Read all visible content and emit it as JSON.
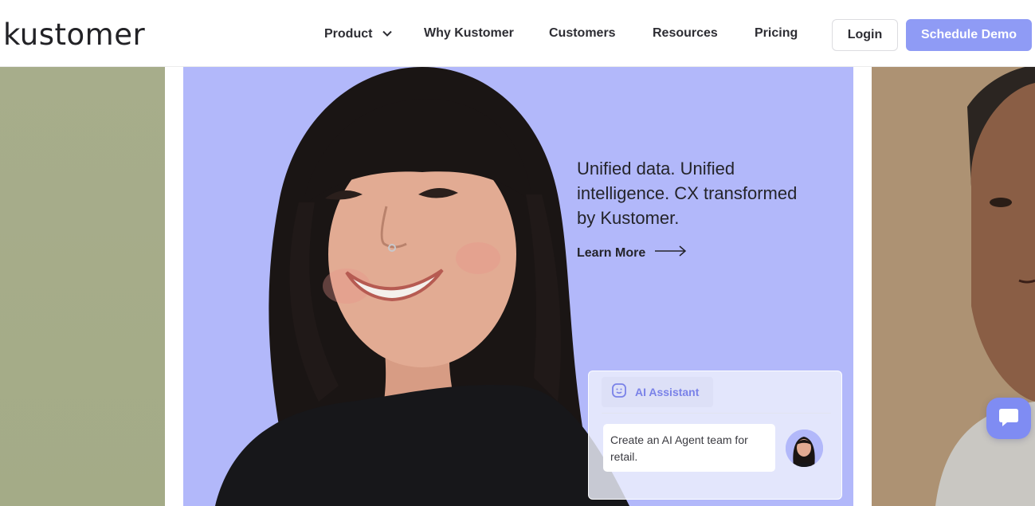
{
  "brand": {
    "logo_text": "kustomer"
  },
  "nav": {
    "items": [
      {
        "label": "Product",
        "has_dropdown": true
      },
      {
        "label": "Why Kustomer",
        "has_dropdown": false
      },
      {
        "label": "Customers",
        "has_dropdown": false
      },
      {
        "label": "Resources",
        "has_dropdown": false
      },
      {
        "label": "Pricing",
        "has_dropdown": false
      }
    ],
    "login_label": "Login",
    "cta_label": "Schedule Demo"
  },
  "hero": {
    "headline": "Unified data. Unified intelligence. CX transformed by Kustomer.",
    "link_label": "Learn More"
  },
  "ai_card": {
    "chip_label": "AI Assistant",
    "message": "Create an AI Agent team for retail."
  },
  "colors": {
    "accent": "#8f9bf5",
    "hero_bg": "#b2b8fa",
    "left_panel": "#a7ad8b",
    "right_panel": "#ad9273",
    "chip_text": "#7a82e8"
  },
  "icons": {
    "nav_dropdown": "chevron-down-icon",
    "learn_more": "arrow-right-icon",
    "ai_chip": "smile-bot-icon",
    "chat": "chat-bubble-icon"
  }
}
